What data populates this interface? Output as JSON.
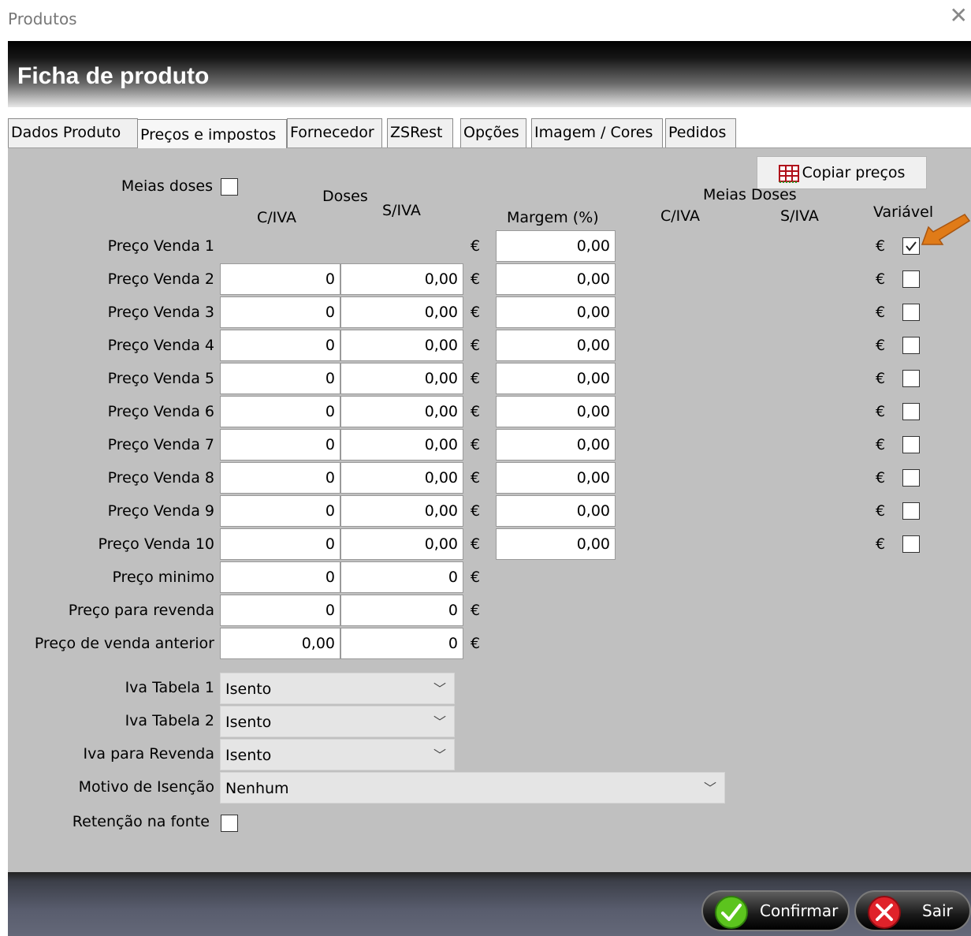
{
  "window": {
    "title": "Produtos",
    "close_icon": "close-icon"
  },
  "header": {
    "title": "Ficha de produto"
  },
  "tabs": [
    {
      "label": "Dados Produto"
    },
    {
      "label": "Preços e impostos",
      "active": true
    },
    {
      "label": "Fornecedor"
    },
    {
      "label": "ZSRest"
    },
    {
      "label": "Opções"
    },
    {
      "label": "Imagem / Cores"
    },
    {
      "label": "Pedidos"
    }
  ],
  "copy_button": {
    "label": "Copiar preços",
    "icon": "table-icon"
  },
  "meias_doses": {
    "label": "Meias doses",
    "checked": false
  },
  "headers": {
    "doses": "Doses",
    "civa": "C/IVA",
    "siva": "S/IVA",
    "margem": "Margem (%)",
    "meias_doses": "Meias Doses",
    "md_civa": "C/IVA",
    "md_siva": "S/IVA",
    "variavel": "Variável"
  },
  "currency": "€",
  "price_rows": [
    {
      "label": "Preço Venda 1",
      "civa": "",
      "siva": "",
      "margem": "0,00",
      "variavel": true
    },
    {
      "label": "Preço Venda 2",
      "civa": "0",
      "siva": "0,00",
      "margem": "0,00",
      "variavel": false
    },
    {
      "label": "Preço Venda 3",
      "civa": "0",
      "siva": "0,00",
      "margem": "0,00",
      "variavel": false
    },
    {
      "label": "Preço Venda 4",
      "civa": "0",
      "siva": "0,00",
      "margem": "0,00",
      "variavel": false
    },
    {
      "label": "Preço Venda 5",
      "civa": "0",
      "siva": "0,00",
      "margem": "0,00",
      "variavel": false
    },
    {
      "label": "Preço Venda 6",
      "civa": "0",
      "siva": "0,00",
      "margem": "0,00",
      "variavel": false
    },
    {
      "label": "Preço Venda 7",
      "civa": "0",
      "siva": "0,00",
      "margem": "0,00",
      "variavel": false
    },
    {
      "label": "Preço Venda 8",
      "civa": "0",
      "siva": "0,00",
      "margem": "0,00",
      "variavel": false
    },
    {
      "label": "Preço Venda 9",
      "civa": "0",
      "siva": "0,00",
      "margem": "0,00",
      "variavel": false
    },
    {
      "label": "Preço Venda 10",
      "civa": "0",
      "siva": "0,00",
      "margem": "0,00",
      "variavel": false
    }
  ],
  "extra_rows": [
    {
      "label": "Preço minimo",
      "civa": "0",
      "siva": "0"
    },
    {
      "label": "Preço para revenda",
      "civa": "0",
      "siva": "0"
    },
    {
      "label": "Preço de venda anterior",
      "civa": "0,00",
      "siva": "0"
    }
  ],
  "selects": [
    {
      "label": "Iva Tabela 1",
      "value": "Isento"
    },
    {
      "label": "Iva Tabela 2",
      "value": "Isento"
    },
    {
      "label": "Iva para Revenda",
      "value": "Isento"
    },
    {
      "label": "Motivo de Isenção",
      "value": "Nenhum"
    }
  ],
  "retencao": {
    "label": "Retenção na fonte",
    "checked": false
  },
  "footer": {
    "confirm_label": "Confirmar",
    "exit_label": "Sair"
  },
  "colors": {
    "arrow": "#e07b18",
    "confirm_icon": "#5cc41e",
    "exit_icon": "#e0222a"
  }
}
